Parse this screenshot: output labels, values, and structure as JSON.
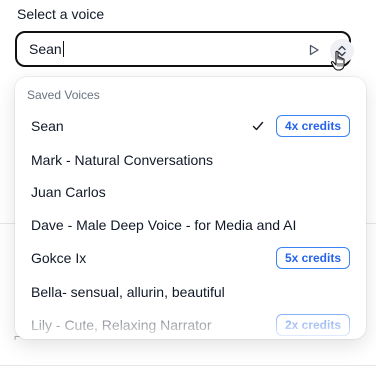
{
  "label": "Select a voice",
  "input": {
    "value": "Sean"
  },
  "icons": {
    "play": "play-icon",
    "chevron": "chevron-up-down-icon",
    "check": "check-icon",
    "cursor": "hand-pointer-icon"
  },
  "dropdown": {
    "group_label": "Saved Voices",
    "options": [
      {
        "label": "Sean",
        "selected": true,
        "badge": "4x credits"
      },
      {
        "label": "Mark - Natural Conversations",
        "selected": false,
        "badge": ""
      },
      {
        "label": "Juan Carlos",
        "selected": false,
        "badge": ""
      },
      {
        "label": "Dave - Male Deep Voice - for Media and AI",
        "selected": false,
        "badge": ""
      },
      {
        "label": "Gokce Ix",
        "selected": false,
        "badge": "5x credits"
      },
      {
        "label": "Bella- sensual, allurin, beautiful",
        "selected": false,
        "badge": ""
      },
      {
        "label": "Lily - Cute, Relaxing Narrator",
        "selected": false,
        "badge": "2x credits"
      }
    ]
  },
  "colors": {
    "accent": "#3b82f6",
    "text": "#111827",
    "muted": "#6b7280"
  }
}
